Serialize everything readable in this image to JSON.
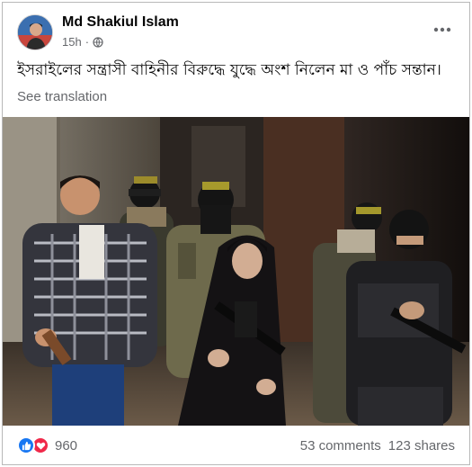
{
  "post": {
    "author": "Md Shakiul Islam",
    "time": "15h",
    "separator": "·",
    "audience_icon": "globe-icon",
    "more_icon": "more-horizontal-icon",
    "caption": "ইসরাইলের সন্ত্রাসী বাহিনীর বিরুদ্ধে যুদ্ধে অংশ নিলেন মা ও পাঁচ সন্তান।",
    "see_translation": "See translation"
  },
  "footer": {
    "reactions": [
      "like-icon",
      "love-icon"
    ],
    "reaction_count": "960",
    "comments": "53 comments",
    "shares": "123 shares"
  },
  "colors": {
    "like": "#1877f2",
    "love": "#f02849",
    "secondary_text": "#65676b",
    "primary_text": "#050505"
  }
}
